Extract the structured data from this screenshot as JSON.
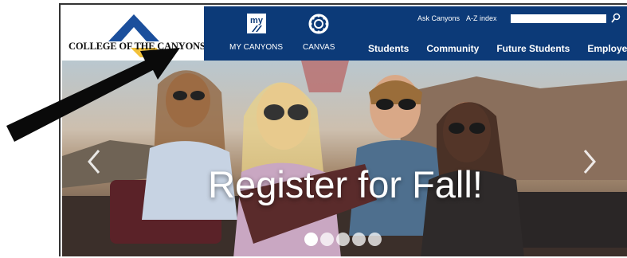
{
  "logo": {
    "text": "COLLEGE OF THE CANYONS"
  },
  "nav_tiles": [
    {
      "label": "MY CANYONS",
      "icon": "my-canyons-icon"
    },
    {
      "label": "CANVAS",
      "icon": "canvas-icon"
    }
  ],
  "top_links": {
    "ask": "Ask Canyons",
    "az": "A-Z index"
  },
  "search": {
    "value": "",
    "icon": "search-icon"
  },
  "main_nav": [
    "Students",
    "Community",
    "Future Students",
    "Employees"
  ],
  "hero": {
    "title": "Register for Fall!",
    "slide_count": 5,
    "active_slide": 1,
    "prev_icon": "chevron-left-icon",
    "next_icon": "chevron-right-icon"
  },
  "colors": {
    "nav_bg": "#0c3a78",
    "logo_blue": "#1b4f9c",
    "logo_gold": "#f2c13a"
  }
}
